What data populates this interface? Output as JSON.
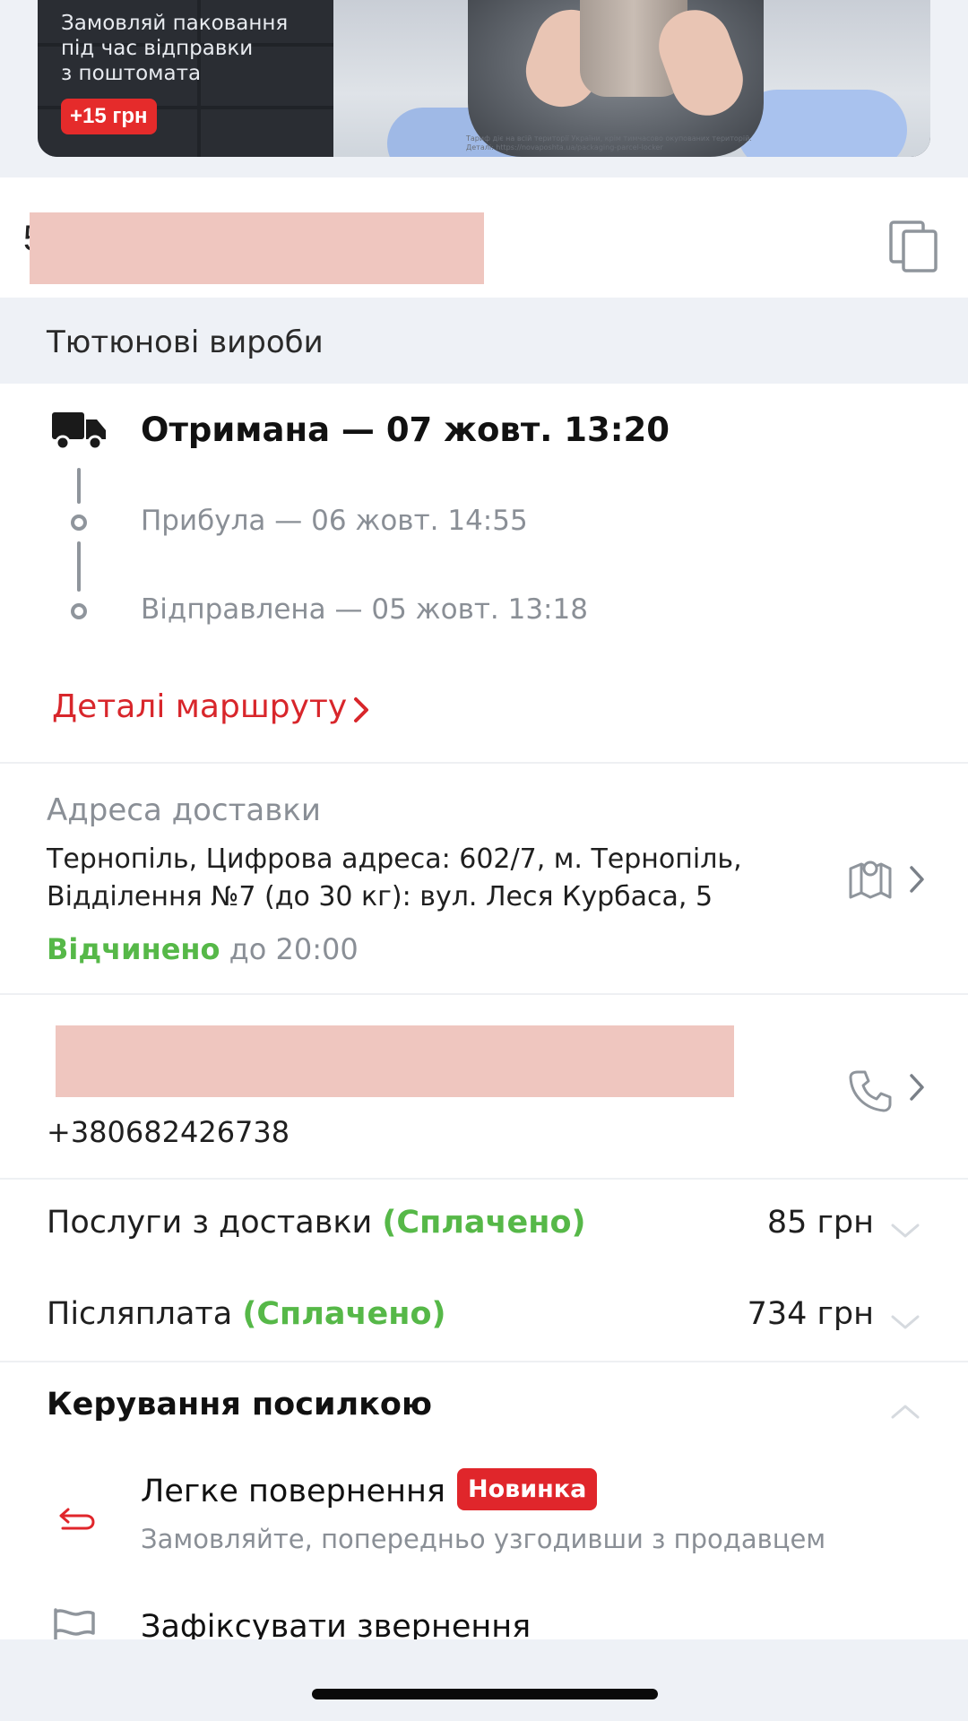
{
  "banner": {
    "text_lines": [
      "Замовляй паковання",
      "під час відправки",
      "з поштомата"
    ],
    "price_badge": "+15 грн",
    "note_lines": [
      "Тариф діє на всій території України, крім тимчасово окупованих територій.",
      "Деталі: https://novaposhta.ua/packaging-parcel-locker"
    ]
  },
  "ttn": {
    "visible_prefix": "5"
  },
  "category": "Тютюнові вироби",
  "status": {
    "current": "Отримана — 07 жовт. 13:20",
    "history": [
      "Прибула — 06 жовт. 14:55",
      "Відправлена — 05 жовт. 13:18"
    ],
    "route_link": "Деталі маршруту"
  },
  "address": {
    "label": "Адреса доставки",
    "lines": [
      "Тернопіль, Цифрова адреса: 602/7, м. Тернопіль,",
      "Відділення №7 (до 30 кг): вул. Леся Курбаса, 5"
    ],
    "open_status": "Відчинено",
    "open_until": " до 20:00"
  },
  "recipient": {
    "phone": "+380682426738"
  },
  "payments": [
    {
      "label": "Послуги з доставки ",
      "status": "(Сплачено)",
      "amount": "85 грн"
    },
    {
      "label": "Післяплата ",
      "status": "(Сплачено)",
      "amount": "734 грн"
    }
  ],
  "manage": {
    "title": "Керування посилкою",
    "return_title": "Легке повернення",
    "return_badge": "Новинка",
    "return_desc": "Замовляйте, попередньо узгодивши з продавцем",
    "complaint": "Зафіксувати звернення"
  },
  "colors": {
    "accent_red": "#d8262b",
    "open_green": "#56b848",
    "muted_grey": "#8a8f96",
    "band_bg": "#eef1f6",
    "redaction": "#efc6bf"
  },
  "icons": [
    "copy-icon",
    "truck-icon",
    "chevron-right-icon",
    "map-icon",
    "phone-icon",
    "chevron-down-icon",
    "chevron-up-icon",
    "return-arrow-icon",
    "flag-icon"
  ]
}
